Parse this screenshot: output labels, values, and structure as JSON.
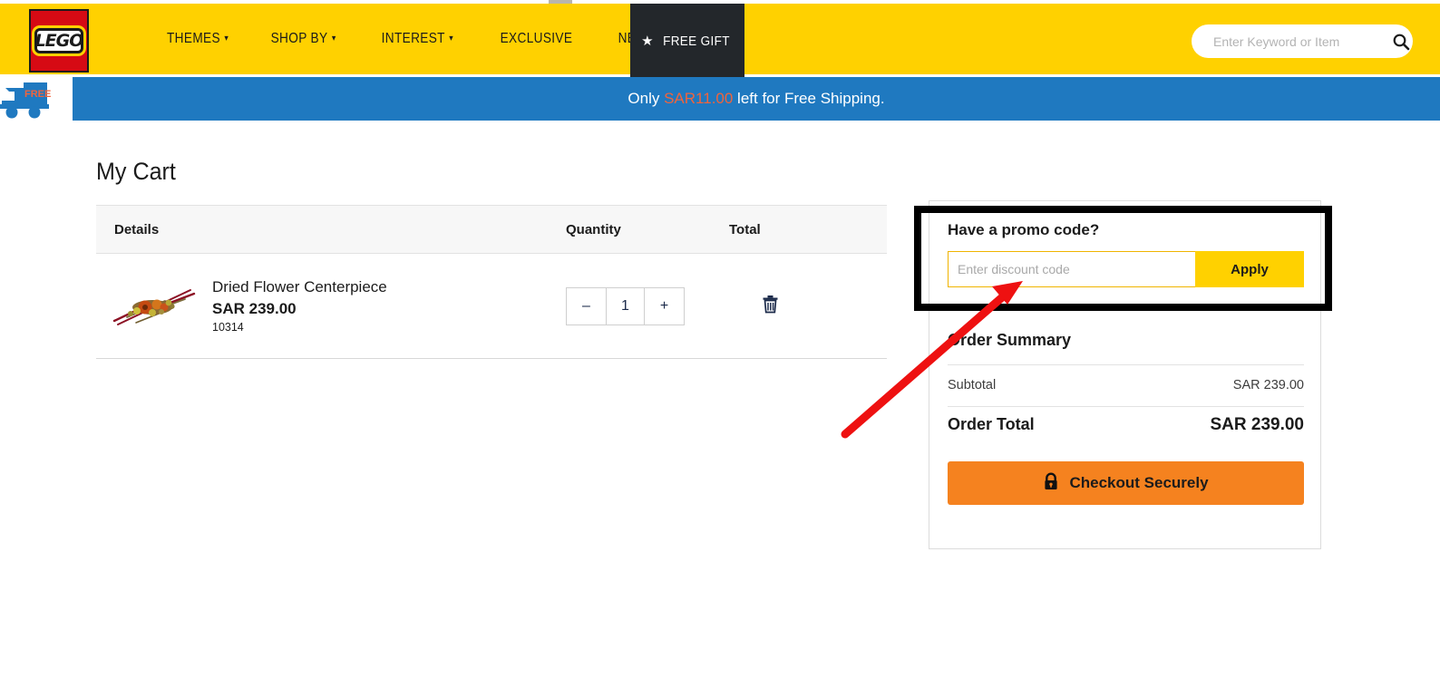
{
  "header": {
    "logo_text": "LEGO",
    "nav_items": [
      {
        "label": "THEMES",
        "has_caret": true
      },
      {
        "label": "SHOP BY",
        "has_caret": true
      },
      {
        "label": "INTEREST",
        "has_caret": true
      },
      {
        "label": "EXCLUSIVE",
        "has_caret": false
      },
      {
        "label": "NEW",
        "has_caret": false
      }
    ],
    "free_gift_label": "FREE GIFT",
    "free_gift_icon": "star-icon",
    "search": {
      "placeholder": "Enter Keyword or Item",
      "value": "",
      "icon": "search-icon"
    },
    "bg_color": "#ffd100",
    "free_gift_bg": "#23272b"
  },
  "shipping_banner": {
    "prefix": "Only ",
    "amount": "SAR11.00",
    "suffix": " left for Free Shipping.",
    "truck_icon": "free-shipping-truck-icon",
    "truck_badge": "FREE",
    "bg_color": "#1f79c0",
    "amount_color": "#f0643c"
  },
  "cart": {
    "title": "My Cart",
    "columns": [
      "Details",
      "Quantity",
      "Total"
    ],
    "items": [
      {
        "thumbnail_icon": "dried-flower-centerpiece-thumbnail",
        "name": "Dried Flower Centerpiece",
        "price": "SAR 239.00",
        "sku": "10314",
        "qty_decrement": "–",
        "qty_value": "1",
        "qty_increment": "+",
        "delete_icon": "trash-icon"
      }
    ]
  },
  "summary": {
    "promo_title": "Have a promo code?",
    "promo_placeholder": "Enter discount code",
    "promo_value": "",
    "apply_label": "Apply",
    "order_summary_title": "Order Summary",
    "rows": [
      {
        "label": "Subtotal",
        "value": "SAR 239.00"
      }
    ],
    "total_label": "Order Total",
    "total_value": "SAR 239.00",
    "checkout_label": "Checkout Securely",
    "checkout_icon": "lock-icon",
    "checkout_color": "#f5821f"
  },
  "annotation": {
    "highlight_color": "#000000",
    "arrow_color": "#ee1111"
  }
}
